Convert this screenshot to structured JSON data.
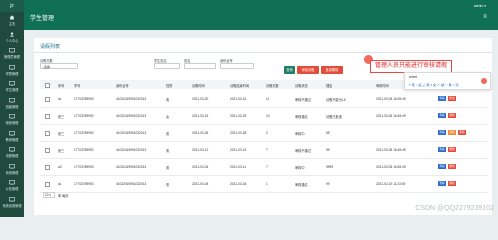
{
  "app": {
    "logo": "jz",
    "title": "学生管理",
    "user": "admin ▾"
  },
  "sidebar": {
    "items": [
      {
        "label": "主页",
        "icon": "home-icon"
      },
      {
        "label": "个人中心",
        "icon": "user-icon"
      },
      {
        "label": "管理员管理",
        "icon": "monitor-icon"
      },
      {
        "label": "学院管理",
        "icon": "monitor-icon"
      },
      {
        "label": "学生管理",
        "icon": "monitor-icon"
      },
      {
        "label": "班级管理",
        "icon": "monitor-icon"
      },
      {
        "label": "宿舍管理",
        "icon": "monitor-icon"
      },
      {
        "label": "教师管理",
        "icon": "monitor-icon"
      },
      {
        "label": "请假管理",
        "icon": "monitor-icon"
      },
      {
        "label": "系统管理",
        "icon": "monitor-icon"
      },
      {
        "label": "公告管理",
        "icon": "monitor-icon"
      },
      {
        "label": "系统设置管理",
        "icon": "monitor-icon"
      }
    ]
  },
  "panel": {
    "title": "请假列表",
    "filters": {
      "name_label": "请假天数",
      "name_value": "- 选择 -",
      "student_label": "学生姓名",
      "class_label": "班名",
      "id_label": "身份证号"
    },
    "buttons": {
      "search": "查询",
      "add": "添加请假",
      "batch": "批量删除"
    }
  },
  "table": {
    "headers": [
      "序号",
      "学号",
      "身份证号",
      "性别",
      "请假时间",
      "请假结束时间",
      "请假天数",
      "请假状态",
      "理由",
      "审核时间",
      "操作"
    ],
    "rows": [
      {
        "no": "a1",
        "sid": "17703789993",
        "idcard": "41032419951032013",
        "sex": "男",
        "start": "2021-03-20",
        "end": "2021-03-31",
        "days": "11",
        "status": "审核不通过",
        "reason": "请假不能为15",
        "time": "2021-03-05 16:45:49",
        "ops": [
          "查看",
          "修改"
        ]
      },
      {
        "no": "张三",
        "sid": "17703789992",
        "idcard": "41032419951032013",
        "sex": "女",
        "start": "2021-03-19",
        "end": "2021-03-29",
        "days": "10",
        "status": "审核通过",
        "reason": "请假已批准",
        "time": "2021-03-05 16:45:49",
        "ops": [
          "查看",
          "删除"
        ]
      },
      {
        "no": "张三",
        "sid": "17703789992",
        "idcard": "41032419951032013",
        "sex": "男",
        "start": "2021-03-26",
        "end": "2021-03-28",
        "days": "2",
        "status": "审核中",
        "reason": "55",
        "time": "",
        "ops": [
          "查看",
          "审核",
          "删除"
        ]
      },
      {
        "no": "张三",
        "sid": "17703789992",
        "idcard": "41032419951032013",
        "sex": "男",
        "start": "2021-03-12",
        "end": "2021-03-19",
        "days": "7",
        "status": "审核不通过",
        "reason": "99",
        "time": "2021-03-05 16:45:49",
        "ops": [
          "查看",
          "删除"
        ]
      },
      {
        "no": "a3",
        "sid": "17703789993",
        "idcard": "41032419951032013",
        "sex": "男",
        "start": "2021-03-04",
        "end": "2021-03-11",
        "days": "7",
        "status": "审核中",
        "reason": "9999",
        "time": "2021-03-05 16:45:49",
        "ops": [
          "查看",
          "删除"
        ]
      },
      {
        "no": "a1",
        "sid": "17703789993",
        "idcard": "41032419951032013",
        "sex": "男",
        "start": "2021-03-04",
        "end": "2021-03-04",
        "days": "1",
        "status": "审核通过",
        "reason": "99",
        "time": "2021-02-19 11:23:00",
        "ops": [
          "查看",
          "删除"
        ]
      }
    ]
  },
  "pager": {
    "size": "10 ▾",
    "text": "条 每页"
  },
  "annotation": {
    "note": "管理人员只能进行审核请假",
    "pop_label": "sheet",
    "pop_tools": "T 矩 ○ 画 ∠ 箭 A 文 ⤺ 撤 ↻ 重 ✓ 完"
  },
  "watermark": "CSDN @QQ2279239102",
  "colors": {
    "topbar": "#0f6f57",
    "sidebar": "#1f4a3d",
    "btn_primary": "#1f7f66",
    "btn_danger": "#e24d3a",
    "btn_view": "#2d6bc9",
    "btn_orange": "#f08a3a"
  }
}
